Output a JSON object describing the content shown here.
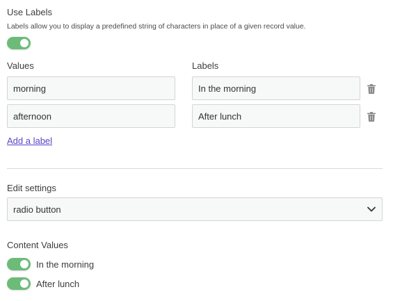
{
  "use_labels": {
    "title": "Use Labels",
    "description": "Labels allow you to display a predefined string of characters in place of a given record value.",
    "enabled": true
  },
  "columns": {
    "values_label": "Values",
    "labels_label": "Labels"
  },
  "rows": [
    {
      "value": "morning",
      "label": "In the morning"
    },
    {
      "value": "afternoon",
      "label": "After lunch"
    }
  ],
  "add_label_link": "Add a label",
  "edit_settings": {
    "title": "Edit settings",
    "selected": "radio button"
  },
  "content_values": {
    "title": "Content Values",
    "items": [
      {
        "label": "In the morning",
        "enabled": true
      },
      {
        "label": "After lunch",
        "enabled": true
      }
    ]
  },
  "colors": {
    "toggle_on": "#6dbb79",
    "link": "#5b45c7",
    "icon": "#8a8a8a"
  }
}
